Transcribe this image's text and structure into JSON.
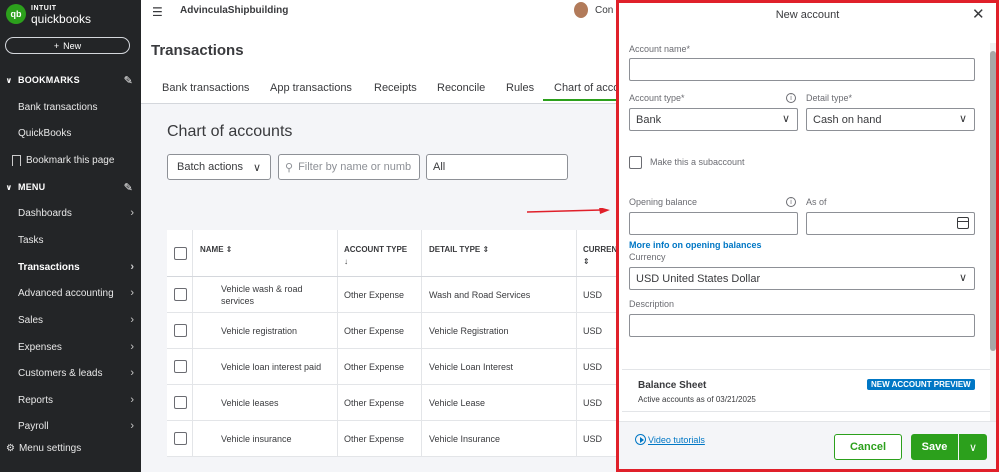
{
  "sidebar": {
    "logo_intuit": "INTUIT",
    "logo_product": "quickbooks",
    "new_label": "New",
    "bookmarks_header": "BOOKMARKS",
    "bookmarks": [
      "Bank transactions",
      "QuickBooks",
      "Bookmark this page"
    ],
    "menu_header": "MENU",
    "menu_items": [
      {
        "label": "Dashboards",
        "arrow": true
      },
      {
        "label": "Tasks",
        "arrow": false
      },
      {
        "label": "Transactions",
        "arrow": true
      },
      {
        "label": "Advanced accounting",
        "arrow": true
      },
      {
        "label": "Sales",
        "arrow": true
      },
      {
        "label": "Expenses",
        "arrow": true
      },
      {
        "label": "Customers & leads",
        "arrow": true
      },
      {
        "label": "Reports",
        "arrow": true
      },
      {
        "label": "Payroll",
        "arrow": true
      }
    ],
    "menu_settings": "Menu settings"
  },
  "header": {
    "company": "AdvinculaShipbuilding",
    "user": "Con"
  },
  "page": {
    "title": "Transactions",
    "tabs": [
      "Bank transactions",
      "App transactions",
      "Receipts",
      "Reconcile",
      "Rules",
      "Chart of acco"
    ],
    "active_tab": "Chart of acco"
  },
  "coa": {
    "title": "Chart of accounts",
    "batch_actions": "Batch actions",
    "filter_placeholder": "Filter by name or numb",
    "all_select": "All",
    "columns": {
      "name": "NAME",
      "account_type": "ACCOUNT TYPE",
      "detail_type": "DETAIL TYPE",
      "currency": "CURREN"
    },
    "rows": [
      {
        "name": "Vehicle wash & road services",
        "type": "Other Expense",
        "detail": "Wash and Road Services",
        "currency": "USD"
      },
      {
        "name": "Vehicle registration",
        "type": "Other Expense",
        "detail": "Vehicle Registration",
        "currency": "USD"
      },
      {
        "name": "Vehicle loan interest paid",
        "type": "Other Expense",
        "detail": "Vehicle Loan Interest",
        "currency": "USD"
      },
      {
        "name": "Vehicle leases",
        "type": "Other Expense",
        "detail": "Vehicle Lease",
        "currency": "USD"
      },
      {
        "name": "Vehicle insurance",
        "type": "Other Expense",
        "detail": "Vehicle Insurance",
        "currency": "USD"
      }
    ]
  },
  "drawer": {
    "title": "New account",
    "account_name_label": "Account name*",
    "account_name_value": "",
    "account_type_label": "Account type*",
    "account_type_value": "Bank",
    "detail_type_label": "Detail type*",
    "detail_type_value": "Cash on hand",
    "subaccount_label": "Make this a subaccount",
    "opening_balance_label": "Opening balance",
    "as_of_label": "As of",
    "opening_info_link": "More info on opening balances",
    "currency_label": "Currency",
    "currency_value": "USD United States Dollar",
    "description_label": "Description",
    "preview_title": "Balance Sheet",
    "preview_sub": "Active accounts as of 03/21/2025",
    "preview_badge": "NEW ACCOUNT PREVIEW",
    "video_link": "Video tutorials",
    "cancel": "Cancel",
    "save": "Save"
  },
  "colors": {
    "accent_green": "#2ca01c",
    "link_blue": "#0077c5",
    "sidebar_bg": "#232527",
    "highlight_red": "#e0202a"
  }
}
